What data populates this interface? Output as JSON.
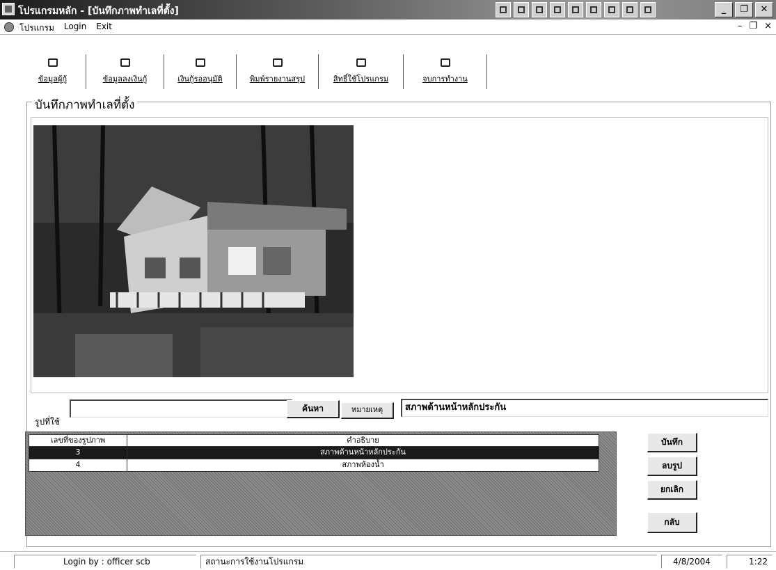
{
  "window": {
    "title": "โปรแกรมหลัก - [บันทึกภาพทำเลที่ตั้ง]",
    "controls": [
      "_",
      "❐",
      "✕"
    ]
  },
  "menu": {
    "items": [
      "โปรแกรม",
      "Login",
      "Exit"
    ],
    "mdi_controls": [
      "–",
      "❐",
      "×"
    ]
  },
  "toolbar": {
    "buttons": [
      {
        "label": "ข้อมูลผู้กู้",
        "icon": "borrower-icon"
      },
      {
        "label": "ข้อมูลลงเงินกู้",
        "icon": "pen-icon"
      },
      {
        "label": "เงินกู้รออนุมัติ",
        "icon": "pending-icon"
      },
      {
        "label": "พิมพ์รายงานสรุป",
        "icon": "print-report-icon"
      },
      {
        "label": "สิทธิ์ใช้โปรแกรม",
        "icon": "user-rights-icon"
      },
      {
        "label": "จบการทำงาน",
        "icon": "exit-icon"
      }
    ]
  },
  "form": {
    "title": "บันทึกภาพทำเลที่ตั้ง",
    "image_label": "รูปที่ใช้",
    "image_value": "",
    "search_button": "ค้นหา",
    "remark_label": "หมายเหตุ",
    "remark_value": "สภาพด้านหน้าหลักประกัน"
  },
  "grid": {
    "headers": [
      "เลขที่ของรูปภาพ",
      "คำอธิบาย"
    ],
    "rows": [
      {
        "id": "3",
        "desc": "สภาพด้านหน้าหลักประกัน",
        "selected": true
      },
      {
        "id": "4",
        "desc": "สภาพห้องน้ำ",
        "selected": false
      }
    ]
  },
  "actions": {
    "save": "บันทึก",
    "delete_image": "ลบรูป",
    "cancel": "ยกเลิก",
    "back": "กลับ"
  },
  "status": {
    "login": "Login by : officer scb",
    "program_status": "สถานะการใช้งานโปรแกรม",
    "date": "4/8/2004",
    "time": "1:22"
  }
}
